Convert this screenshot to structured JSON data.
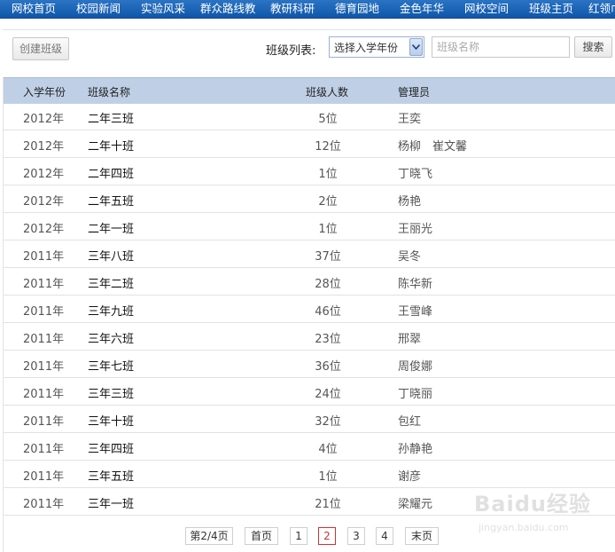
{
  "nav": {
    "items": [
      "网校首页",
      "校园新闻",
      "实验风采",
      "群众路线教",
      "教研科研",
      "德育园地",
      "金色年华",
      "网校空间",
      "班级主页",
      "红领巾"
    ]
  },
  "toolbar": {
    "create_label": "创建班级",
    "list_label": "班级列表:",
    "select_value": "选择入学年份",
    "name_placeholder": "班级名称",
    "search_label": "搜索"
  },
  "table": {
    "headers": {
      "year": "入学年份",
      "name": "班级名称",
      "count": "班级人数",
      "admin": "管理员"
    },
    "rows": [
      {
        "year": "2012年",
        "name": "二年三班",
        "count": "5位",
        "admin": "王奕"
      },
      {
        "year": "2012年",
        "name": "二年十班",
        "count": "12位",
        "admin": "杨柳　崔文馨"
      },
      {
        "year": "2012年",
        "name": "二年四班",
        "count": "1位",
        "admin": "丁晓飞"
      },
      {
        "year": "2012年",
        "name": "二年五班",
        "count": "2位",
        "admin": "杨艳"
      },
      {
        "year": "2012年",
        "name": "二年一班",
        "count": "1位",
        "admin": "王丽光"
      },
      {
        "year": "2011年",
        "name": "三年八班",
        "count": "37位",
        "admin": "吴冬"
      },
      {
        "year": "2011年",
        "name": "三年二班",
        "count": "28位",
        "admin": "陈华新"
      },
      {
        "year": "2011年",
        "name": "三年九班",
        "count": "46位",
        "admin": "王雪峰"
      },
      {
        "year": "2011年",
        "name": "三年六班",
        "count": "23位",
        "admin": "邢翠"
      },
      {
        "year": "2011年",
        "name": "三年七班",
        "count": "36位",
        "admin": "周俊娜"
      },
      {
        "year": "2011年",
        "name": "三年三班",
        "count": "24位",
        "admin": "丁晓丽"
      },
      {
        "year": "2011年",
        "name": "三年十班",
        "count": "32位",
        "admin": "包红"
      },
      {
        "year": "2011年",
        "name": "三年四班",
        "count": "4位",
        "admin": "孙静艳"
      },
      {
        "year": "2011年",
        "name": "三年五班",
        "count": "1位",
        "admin": "谢彦"
      },
      {
        "year": "2011年",
        "name": "三年一班",
        "count": "21位",
        "admin": "梁耀元"
      }
    ]
  },
  "pager": {
    "info": "第2/4页",
    "first": "首页",
    "pages": [
      "1",
      "2",
      "3",
      "4"
    ],
    "current": "2",
    "last": "末页"
  },
  "watermark": {
    "logo": "Baidu经验",
    "url": "jingyan.baidu.com"
  }
}
